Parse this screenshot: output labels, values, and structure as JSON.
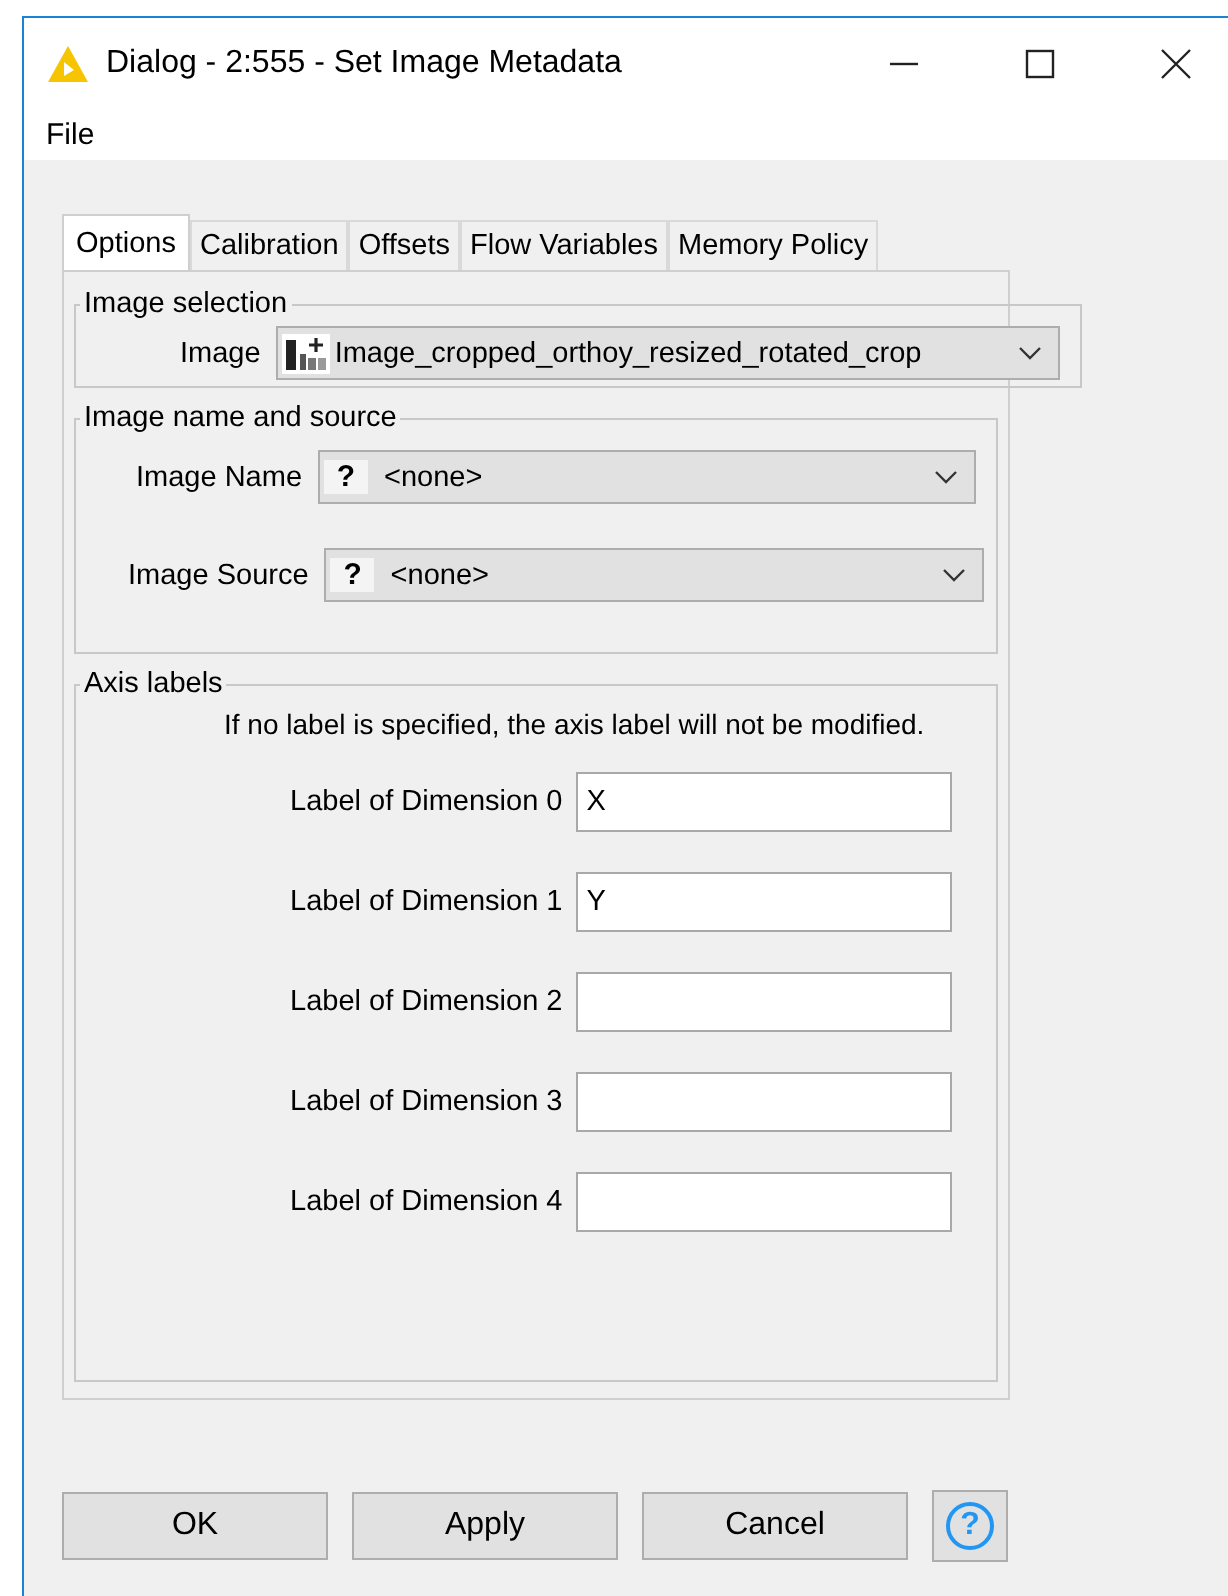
{
  "window": {
    "title": "Dialog - 2:555 - Set Image Metadata"
  },
  "menu": [
    "File"
  ],
  "tabs": [
    {
      "label": "Options",
      "selected": true
    },
    {
      "label": "Calibration",
      "selected": false
    },
    {
      "label": "Offsets",
      "selected": false
    },
    {
      "label": "Flow Variables",
      "selected": false
    },
    {
      "label": "Memory Policy",
      "selected": false
    }
  ],
  "image_selection": {
    "title": "Image selection",
    "label": "Image",
    "value": "Image_cropped_orthoy_resized_rotated_crop"
  },
  "image_name_and_source": {
    "title": "Image name and source",
    "fields": [
      {
        "label": "Image Name",
        "icon": "?",
        "value": "<none>"
      },
      {
        "label": "Image Source",
        "icon": "?",
        "value": "<none>"
      }
    ]
  },
  "axis_labels": {
    "title": "Axis labels",
    "note": "If no label is specified, the axis label will not be modified.",
    "fields": [
      {
        "label": "Label of Dimension 0",
        "value": "X"
      },
      {
        "label": "Label of Dimension 1",
        "value": "Y"
      },
      {
        "label": "Label of Dimension 2"
      },
      {
        "label": "Label of Dimension 3"
      },
      {
        "label": "Label of Dimension 4"
      }
    ]
  },
  "buttons": [
    "OK",
    "Apply",
    "Cancel"
  ],
  "help_button": "?"
}
